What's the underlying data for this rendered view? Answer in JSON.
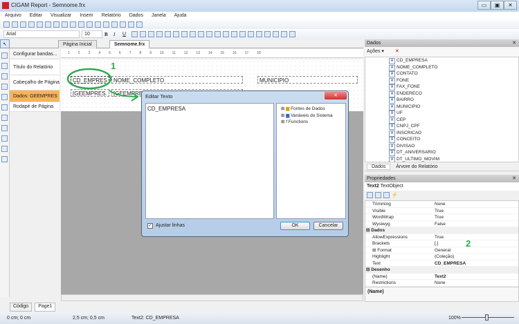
{
  "window": {
    "title": "CIGAM Report - Semnome.frx",
    "min": "▭",
    "max": "▣",
    "close": "✕"
  },
  "menu": [
    "Arquivo",
    "Editar",
    "Visualizar",
    "Inserir",
    "Relatório",
    "Dados",
    "Janela",
    "Ajuda"
  ],
  "toolbar": {
    "font": "Arial",
    "size": "10",
    "bold": "B",
    "italic": "I",
    "underline": "U"
  },
  "tabs": [
    {
      "label": "Página Inicial"
    },
    {
      "label": "Semnome.frx"
    }
  ],
  "bands": {
    "configure": "Configurar bandas...",
    "items": [
      "Título do Relatório",
      "Cabeçalho de Página",
      "Dados: GEEMPRES",
      "Rodapé de Página"
    ]
  },
  "ruler": [
    "1",
    "2",
    "3",
    "4",
    "5",
    "6",
    "7",
    "8",
    "9",
    "10",
    "11",
    "12",
    "13",
    "14",
    "15",
    "16",
    "17",
    "18"
  ],
  "report": {
    "header_fields": [
      "CD_EMPRES",
      "NOME_COMPLETO",
      "MUNICIPIO"
    ],
    "data_fields": [
      "[GEEMPRES.",
      "[GEEMPRE"
    ]
  },
  "annotations": {
    "one": "1",
    "two": "2",
    "color": "#2fa84f"
  },
  "dialog": {
    "title": "Editar Texto",
    "text": "CD_EMPRESA",
    "tree": [
      "Fontes de Dados",
      "Variáveis do Sistema",
      "Functions"
    ],
    "wrap_label": "Ajustar linhas",
    "wrap_checked": true,
    "ok": "OK",
    "cancel": "Cancelar"
  },
  "data_panel": {
    "title": "Dados",
    "actions": "Ações",
    "fields": [
      "CD_EMPRESA",
      "NOME_COMPLETO",
      "CONTATO",
      "FONE",
      "FAX_FONE",
      "ENDERECO",
      "BAIRRO",
      "MUNICIPIO",
      "UF",
      "CEP",
      "CNPJ_CPF",
      "INSCRICAO",
      "CONCEITO",
      "DIVISAO",
      "DT_ANIVERSARIO",
      "DT_ULTIMO_MOVIM"
    ],
    "tabs": [
      "Dados",
      "Árvore do Relatório"
    ]
  },
  "props": {
    "title": "Propriedades",
    "object_name": "Text2",
    "object_type": "TextObject",
    "rows": [
      {
        "k": "Trimming",
        "v": "None"
      },
      {
        "k": "Visible",
        "v": "True"
      },
      {
        "k": "WordWrap",
        "v": "True"
      },
      {
        "k": "Wysiwyg",
        "v": "False"
      },
      {
        "k": "⊟ Dados",
        "v": "",
        "cat": true
      },
      {
        "k": "AllowExpressions",
        "v": "True"
      },
      {
        "k": "Brackets",
        "v": "[,]"
      },
      {
        "k": "⊞ Format",
        "v": "General"
      },
      {
        "k": "Highlight",
        "v": "(Coleção)"
      },
      {
        "k": "Text",
        "v": "CD_EMPRESA",
        "bold": true
      },
      {
        "k": "⊟ Desenho",
        "v": "",
        "cat": true
      },
      {
        "k": "(Name)",
        "v": "Text2",
        "bold": true
      },
      {
        "k": "Restrictions",
        "v": "None"
      }
    ],
    "description": "(Name)"
  },
  "bottom_tabs": [
    "Código",
    "Page1"
  ],
  "status": {
    "pos": "0 cm; 0 cm",
    "size": "2,5 cm; 0,5 cm",
    "object": "Text2:  CD_EMPRESA",
    "zoom": "100%"
  }
}
